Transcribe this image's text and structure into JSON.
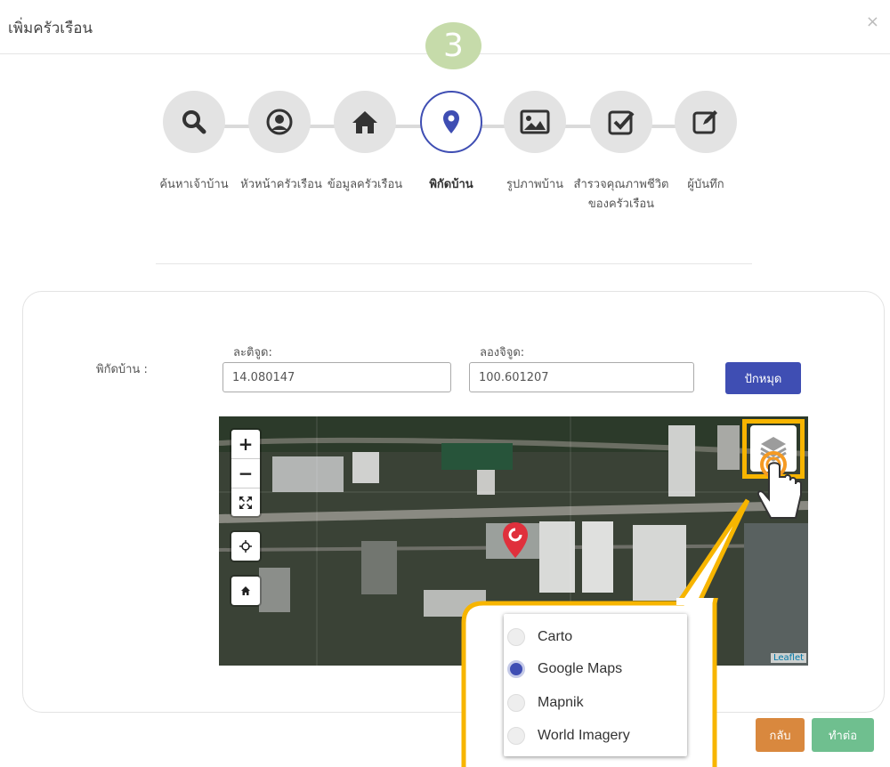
{
  "dialog": {
    "title": "เพิ่มครัวเรือน",
    "close_label": "×"
  },
  "step_badge": "3",
  "steps": [
    {
      "label": "ค้นหาเจ้าบ้าน",
      "icon": "search-icon"
    },
    {
      "label": "หัวหน้าครัวเรือน",
      "icon": "user-icon"
    },
    {
      "label": "ข้อมูลครัวเรือน",
      "icon": "home-icon"
    },
    {
      "label": "พิกัดบ้าน",
      "icon": "map-pin-icon",
      "active": true
    },
    {
      "label": "รูปภาพบ้าน",
      "icon": "image-icon"
    },
    {
      "label": "สำรวจคุณภาพชีวิตของครัวเรือน",
      "icon": "checkbox-icon"
    },
    {
      "label": "ผู้บันทึก",
      "icon": "edit-icon"
    }
  ],
  "form": {
    "label": "พิกัดบ้าน :",
    "lat_label": "ละติจูด:",
    "lat_value": "14.080147",
    "lng_label": "ลองจิจูด:",
    "lng_value": "100.601207",
    "pin_button": "ปักหมุด"
  },
  "map": {
    "zoom_in": "+",
    "zoom_out": "−",
    "attribution": "Leaflet",
    "layers": [
      {
        "label": "Carto",
        "selected": false
      },
      {
        "label": "Google Maps",
        "selected": true
      },
      {
        "label": "Mapnik",
        "selected": false
      },
      {
        "label": "World Imagery",
        "selected": false
      }
    ]
  },
  "footer": {
    "back": "กลับ",
    "next": "ทำต่อ"
  },
  "colors": {
    "primary": "#3f4eb3",
    "highlight": "#f7b500",
    "back": "#d9883e",
    "next": "#6fbf8f",
    "badge": "#c6dbaa",
    "marker": "#e0303c"
  }
}
